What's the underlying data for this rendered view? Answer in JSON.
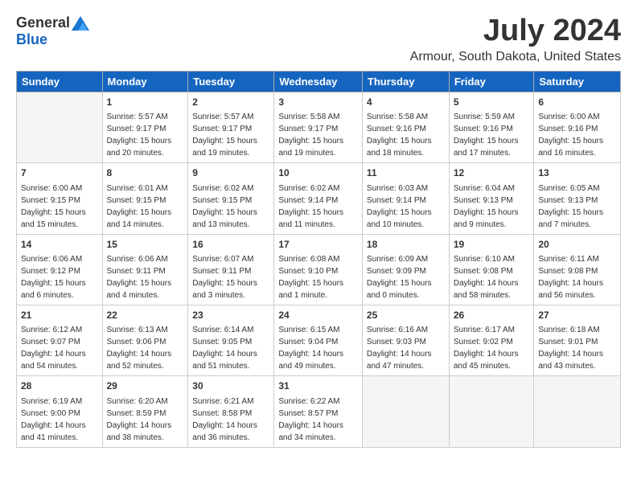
{
  "logo": {
    "general": "General",
    "blue": "Blue"
  },
  "title": "July 2024",
  "subtitle": "Armour, South Dakota, United States",
  "days_of_week": [
    "Sunday",
    "Monday",
    "Tuesday",
    "Wednesday",
    "Thursday",
    "Friday",
    "Saturday"
  ],
  "weeks": [
    [
      {
        "day": "",
        "info": ""
      },
      {
        "day": "1",
        "info": "Sunrise: 5:57 AM\nSunset: 9:17 PM\nDaylight: 15 hours\nand 20 minutes."
      },
      {
        "day": "2",
        "info": "Sunrise: 5:57 AM\nSunset: 9:17 PM\nDaylight: 15 hours\nand 19 minutes."
      },
      {
        "day": "3",
        "info": "Sunrise: 5:58 AM\nSunset: 9:17 PM\nDaylight: 15 hours\nand 19 minutes."
      },
      {
        "day": "4",
        "info": "Sunrise: 5:58 AM\nSunset: 9:16 PM\nDaylight: 15 hours\nand 18 minutes."
      },
      {
        "day": "5",
        "info": "Sunrise: 5:59 AM\nSunset: 9:16 PM\nDaylight: 15 hours\nand 17 minutes."
      },
      {
        "day": "6",
        "info": "Sunrise: 6:00 AM\nSunset: 9:16 PM\nDaylight: 15 hours\nand 16 minutes."
      }
    ],
    [
      {
        "day": "7",
        "info": "Sunrise: 6:00 AM\nSunset: 9:15 PM\nDaylight: 15 hours\nand 15 minutes."
      },
      {
        "day": "8",
        "info": "Sunrise: 6:01 AM\nSunset: 9:15 PM\nDaylight: 15 hours\nand 14 minutes."
      },
      {
        "day": "9",
        "info": "Sunrise: 6:02 AM\nSunset: 9:15 PM\nDaylight: 15 hours\nand 13 minutes."
      },
      {
        "day": "10",
        "info": "Sunrise: 6:02 AM\nSunset: 9:14 PM\nDaylight: 15 hours\nand 11 minutes."
      },
      {
        "day": "11",
        "info": "Sunrise: 6:03 AM\nSunset: 9:14 PM\nDaylight: 15 hours\nand 10 minutes."
      },
      {
        "day": "12",
        "info": "Sunrise: 6:04 AM\nSunset: 9:13 PM\nDaylight: 15 hours\nand 9 minutes."
      },
      {
        "day": "13",
        "info": "Sunrise: 6:05 AM\nSunset: 9:13 PM\nDaylight: 15 hours\nand 7 minutes."
      }
    ],
    [
      {
        "day": "14",
        "info": "Sunrise: 6:06 AM\nSunset: 9:12 PM\nDaylight: 15 hours\nand 6 minutes."
      },
      {
        "day": "15",
        "info": "Sunrise: 6:06 AM\nSunset: 9:11 PM\nDaylight: 15 hours\nand 4 minutes."
      },
      {
        "day": "16",
        "info": "Sunrise: 6:07 AM\nSunset: 9:11 PM\nDaylight: 15 hours\nand 3 minutes."
      },
      {
        "day": "17",
        "info": "Sunrise: 6:08 AM\nSunset: 9:10 PM\nDaylight: 15 hours\nand 1 minute."
      },
      {
        "day": "18",
        "info": "Sunrise: 6:09 AM\nSunset: 9:09 PM\nDaylight: 15 hours\nand 0 minutes."
      },
      {
        "day": "19",
        "info": "Sunrise: 6:10 AM\nSunset: 9:08 PM\nDaylight: 14 hours\nand 58 minutes."
      },
      {
        "day": "20",
        "info": "Sunrise: 6:11 AM\nSunset: 9:08 PM\nDaylight: 14 hours\nand 56 minutes."
      }
    ],
    [
      {
        "day": "21",
        "info": "Sunrise: 6:12 AM\nSunset: 9:07 PM\nDaylight: 14 hours\nand 54 minutes."
      },
      {
        "day": "22",
        "info": "Sunrise: 6:13 AM\nSunset: 9:06 PM\nDaylight: 14 hours\nand 52 minutes."
      },
      {
        "day": "23",
        "info": "Sunrise: 6:14 AM\nSunset: 9:05 PM\nDaylight: 14 hours\nand 51 minutes."
      },
      {
        "day": "24",
        "info": "Sunrise: 6:15 AM\nSunset: 9:04 PM\nDaylight: 14 hours\nand 49 minutes."
      },
      {
        "day": "25",
        "info": "Sunrise: 6:16 AM\nSunset: 9:03 PM\nDaylight: 14 hours\nand 47 minutes."
      },
      {
        "day": "26",
        "info": "Sunrise: 6:17 AM\nSunset: 9:02 PM\nDaylight: 14 hours\nand 45 minutes."
      },
      {
        "day": "27",
        "info": "Sunrise: 6:18 AM\nSunset: 9:01 PM\nDaylight: 14 hours\nand 43 minutes."
      }
    ],
    [
      {
        "day": "28",
        "info": "Sunrise: 6:19 AM\nSunset: 9:00 PM\nDaylight: 14 hours\nand 41 minutes."
      },
      {
        "day": "29",
        "info": "Sunrise: 6:20 AM\nSunset: 8:59 PM\nDaylight: 14 hours\nand 38 minutes."
      },
      {
        "day": "30",
        "info": "Sunrise: 6:21 AM\nSunset: 8:58 PM\nDaylight: 14 hours\nand 36 minutes."
      },
      {
        "day": "31",
        "info": "Sunrise: 6:22 AM\nSunset: 8:57 PM\nDaylight: 14 hours\nand 34 minutes."
      },
      {
        "day": "",
        "info": ""
      },
      {
        "day": "",
        "info": ""
      },
      {
        "day": "",
        "info": ""
      }
    ]
  ]
}
